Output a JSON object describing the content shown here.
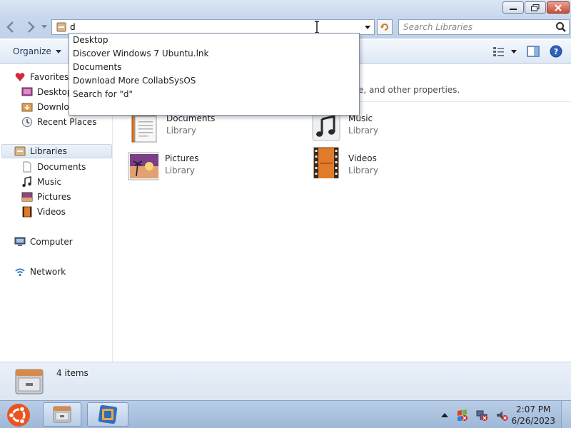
{
  "window": {
    "search_placeholder": "Search Libraries",
    "address_value": "d"
  },
  "toolbar": {
    "organize_label": "Organize"
  },
  "sidebar": {
    "favorites": "Favorites",
    "desktop": "Desktop",
    "downloads": "Downloa",
    "recent_places": "Recent Places",
    "libraries": "Libraries",
    "documents": "Documents",
    "music": "Music",
    "pictures": "Pictures",
    "videos": "Videos",
    "computer": "Computer",
    "network": "Network"
  },
  "main": {
    "description": "e, and other properties.",
    "items": [
      {
        "name": "Documents",
        "type": "Library"
      },
      {
        "name": "Music",
        "type": "Library"
      },
      {
        "name": "Pictures",
        "type": "Library"
      },
      {
        "name": "Videos",
        "type": "Library"
      }
    ]
  },
  "autocomplete": {
    "items": [
      "Desktop",
      "Discover Windows 7 Ubuntu.lnk",
      "Documents",
      "Download More CollabSysOS",
      "Search for \"d\""
    ]
  },
  "details": {
    "item_count": "4 items"
  },
  "taskbar": {
    "time": "2:07 PM",
    "date": "6/26/2023"
  },
  "colors": {
    "accent": "#1e395b",
    "selection": "#dde7f3",
    "close_button": "#c74b3a"
  }
}
